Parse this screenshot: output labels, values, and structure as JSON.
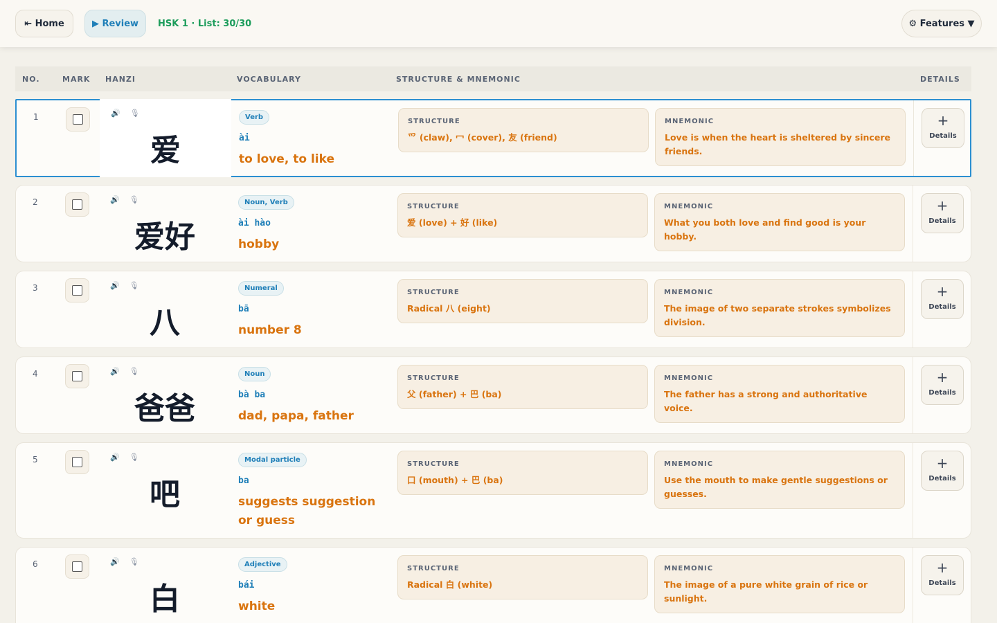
{
  "toolbar": {
    "home_label": "⇤ Home",
    "review_label": "▶ Review",
    "list_info": "HSK 1 · List: 30/30",
    "features_label": "⚙ Features ▼"
  },
  "columns": {
    "no": "NO.",
    "mark": "MARK",
    "hanzi": "HANZI",
    "vocabulary": "VOCABULARY",
    "structure": "STRUCTURE & MNEMONIC",
    "details": "DETAILS"
  },
  "labels": {
    "structure": "STRUCTURE",
    "mnemonic": "MNEMONIC",
    "details": "Details",
    "plus": "+",
    "audio_icon": "🔊",
    "mic_icon": "🎙"
  },
  "rows": [
    {
      "no": "1",
      "hanzi": "爱",
      "pos": "Verb",
      "pinyin": "ài",
      "meaning": "to love, to like",
      "structure": "爫 (claw), 冖 (cover), 友 (friend)",
      "mnemonic": "Love is when the heart is sheltered by sincere friends."
    },
    {
      "no": "2",
      "hanzi": "爱好",
      "pos": "Noun, Verb",
      "pinyin": "ài hào",
      "meaning": "hobby",
      "structure": "爱 (love) + 好 (like)",
      "mnemonic": "What you both love and find good is your hobby."
    },
    {
      "no": "3",
      "hanzi": "八",
      "pos": "Numeral",
      "pinyin": "bā",
      "meaning": "number 8",
      "structure": "Radical 八 (eight)",
      "mnemonic": "The image of two separate strokes symbolizes division."
    },
    {
      "no": "4",
      "hanzi": "爸爸",
      "pos": "Noun",
      "pinyin": "bà ba",
      "meaning": "dad, papa, father",
      "structure": "父 (father) + 巴 (ba)",
      "mnemonic": "The father has a strong and authoritative voice."
    },
    {
      "no": "5",
      "hanzi": "吧",
      "pos": "Modal particle",
      "pinyin": "ba",
      "meaning": "suggests suggestion or guess",
      "structure": "口 (mouth) + 巴 (ba)",
      "mnemonic": "Use the mouth to make gentle suggestions or guesses."
    },
    {
      "no": "6",
      "hanzi": "白",
      "pos": "Adjective",
      "pinyin": "bái",
      "meaning": "white",
      "structure": "Radical 白 (white)",
      "mnemonic": "The image of a pure white grain of rice or sunlight."
    }
  ]
}
